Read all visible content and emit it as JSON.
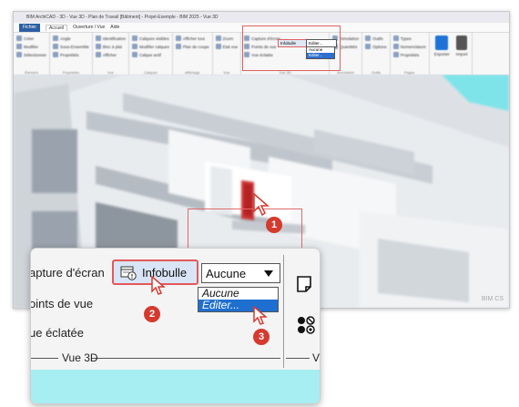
{
  "app": {
    "title": "BIM ArchiCAD - 3D - Vue 3D - Plan de Travail [Bâtiment] - Projet-Exemple - BIM 2025 - Vue 3D",
    "menu": {
      "file": "Fichier",
      "tabs": [
        "Accueil",
        "Ouverture / Vue",
        "Aide"
      ]
    },
    "ribbon": {
      "groups": [
        {
          "items": [
            "Créer",
            "Modifier",
            "Sélectionner"
          ],
          "label": "Élément"
        },
        {
          "items": [
            "Angle",
            "Sous-Ensemble",
            "Propriétés"
          ],
          "label": "Propriétés"
        },
        {
          "items": [
            "Identification",
            "Bloc à plat",
            "Afficher"
          ],
          "label": "Vue"
        },
        {
          "items": [
            "Calques visibles",
            "Modifier calques",
            "Calque actif"
          ],
          "label": "Calques"
        },
        {
          "items": [
            "Afficher tout",
            "Plan de coupe",
            "Sous-projets"
          ],
          "label": "Affichage"
        },
        {
          "items": [
            "Zoom",
            "Etat vue",
            "Centrer"
          ],
          "label": "Vue"
        },
        {
          "items": [
            "Capture d'écran",
            "Points de vue",
            "Vue éclatée"
          ],
          "label": "Vue 3D"
        },
        {
          "items": [
            "Simulation",
            "Quantités"
          ],
          "label": "Annotation"
        },
        {
          "items": [
            "Outils",
            "Options"
          ],
          "label": "Outils"
        },
        {
          "items": [
            "Types",
            "Nomenclature",
            "Propriétés"
          ],
          "label": "Pages"
        }
      ],
      "big_buttons": [
        "Exporter",
        "Import"
      ],
      "mini_info": "Infobulle",
      "mini_select": "Editer...",
      "mini_options": [
        "Aucune",
        "Editer..."
      ]
    },
    "watermark": "BIM CS"
  },
  "callout": {
    "labels": [
      "apture d'écran",
      "oints de vue",
      "ue éclatée"
    ],
    "info_button": "Infobulle",
    "select_value": "Aucune",
    "options": [
      "Aucune",
      "Editer..."
    ],
    "group_label": "Vue 3D",
    "group_label_next": "V"
  },
  "steps": [
    "1",
    "2",
    "3"
  ],
  "colors": {
    "highlight": "#e4585a",
    "badge": "#d63a2f",
    "selected": "#1f6fd0",
    "cyan": "#a6eef2"
  }
}
